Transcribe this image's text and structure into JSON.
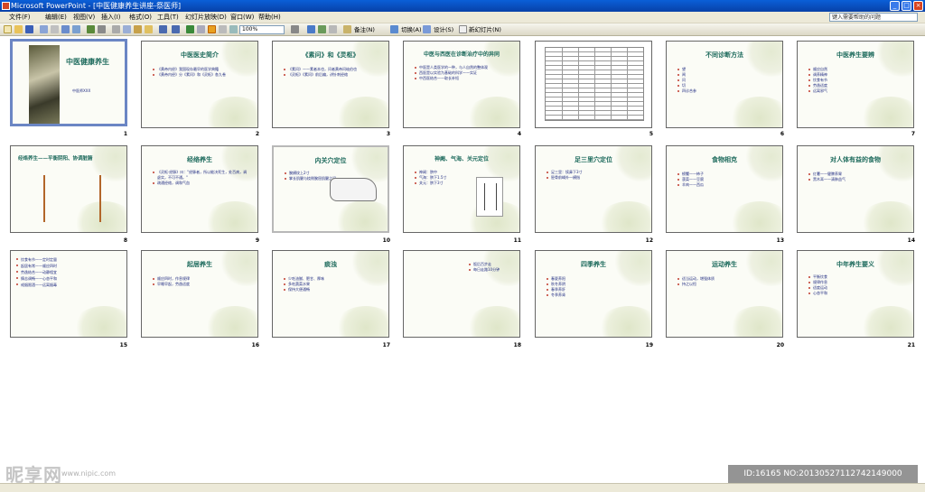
{
  "window": {
    "title": "Microsoft PowerPoint - [中医健康养生讲座-祭医师]",
    "controls": [
      "_",
      "□",
      "×"
    ]
  },
  "menu": {
    "items": [
      "文件(F)",
      "编辑(E)",
      "视图(V)",
      "插入(I)",
      "格式(O)",
      "工具(T)",
      "幻灯片放映(D)",
      "窗口(W)",
      "帮助(H)"
    ],
    "help_placeholder": "键入需要帮助的问题"
  },
  "toolbar": {
    "zoom": "100%",
    "design_label": "设计(S)",
    "new_slide_label": "新幻灯片(N)",
    "notes_label": "备注(N)",
    "transition_label": "切换(A)"
  },
  "slides": [
    {
      "n": "1",
      "title": "中医健康养生",
      "body": [
        "中医师XXX"
      ]
    },
    {
      "n": "2",
      "title": "中医医史简介",
      "body": [
        "《黄帝内经》我国现存最早的医学典籍",
        "《黄帝内经》分《素问》和《灵枢》各九卷"
      ]
    },
    {
      "n": "3",
      "title": "《素问》和《灵枢》",
      "body": [
        "《素问》——素者本也，问者黄帝问岐伯也",
        "《灵枢》《素问》前后编，讲针刺经络"
      ]
    },
    {
      "n": "4",
      "title": "中医与西医在诊断治疗中的异同",
      "body": [
        "中医是人类医学的一种，与人自然的整体观",
        "西医是以实验为基础的科学——实证",
        "中西医结合——取长补短"
      ]
    },
    {
      "n": "5",
      "title": "",
      "body": []
    },
    {
      "n": "6",
      "title": "不同诊断方法",
      "body": [
        "望",
        "闻",
        "问",
        "切",
        "四诊合参"
      ]
    },
    {
      "n": "7",
      "title": "中医养生要辨",
      "body": [
        "顺应自然",
        "调养精神",
        "饮食有节",
        "劳逸适度",
        "远离邪气"
      ]
    },
    {
      "n": "8",
      "title": "经络养生——平衡阴阳、协调脏腑",
      "body": []
    },
    {
      "n": "9",
      "title": "经络养生",
      "body": [
        "《灵枢·经脉》曰：\"经脉者，所以能决死生，处百病，调虚实，不可不通。\"",
        "疏通经络，调和气血"
      ]
    },
    {
      "n": "10",
      "title": "内关穴定位",
      "body": [
        "腕横纹上2寸",
        "掌长肌腱与桡侧腕屈肌腱之间"
      ]
    },
    {
      "n": "11",
      "title": "神阙、气海、关元定位",
      "body": [
        "神阙：脐中",
        "气海：脐下1.5寸",
        "关元：脐下3寸"
      ]
    },
    {
      "n": "12",
      "title": "足三里穴定位",
      "body": [
        "足三里：犊鼻下3寸",
        "胫骨前嵴外一横指"
      ]
    },
    {
      "n": "13",
      "title": "食物相克",
      "body": [
        "螃蟹——柿子",
        "菠菜——豆腐",
        "羊肉——西瓜"
      ]
    },
    {
      "n": "14",
      "title": "对人体有益的食物",
      "body": [
        "红薯——健脾养胃",
        "黑木耳——清肺益气"
      ]
    },
    {
      "n": "15",
      "title": "",
      "body": [
        "饮食有节——定时定量",
        "起居有常——顺应四时",
        "劳逸结合——动静相宜",
        "情志调畅——心态平和",
        "戒烟限酒——远离烟毒"
      ]
    },
    {
      "n": "16",
      "title": "起居养生",
      "body": [
        "顺应四时，作息规律",
        "早睡早起，劳逸适度"
      ]
    },
    {
      "n": "17",
      "title": "痰浊",
      "body": [
        "少吃油腻、肥甘、厚味",
        "多吃蔬菜水果",
        "保持大便通畅"
      ]
    },
    {
      "n": "18",
      "title": "",
      "body": [
        "饭后百步走",
        "每日走路10分钟"
      ]
    },
    {
      "n": "19",
      "title": "四季养生",
      "body": [
        "春夏养阳",
        "秋冬养阴",
        "春季养肝",
        "冬季养肾"
      ]
    },
    {
      "n": "20",
      "title": "运动养生",
      "body": [
        "适当运动，增强体质",
        "持之以恒"
      ]
    },
    {
      "n": "21",
      "title": "中年养生要义",
      "body": [
        "平衡饮食",
        "规律作息",
        "适度运动",
        "心态平和"
      ]
    }
  ],
  "watermark": {
    "site": "昵享网",
    "url": "www.nipic.com",
    "id": "ID:16165 NO:20130527112742149000"
  }
}
